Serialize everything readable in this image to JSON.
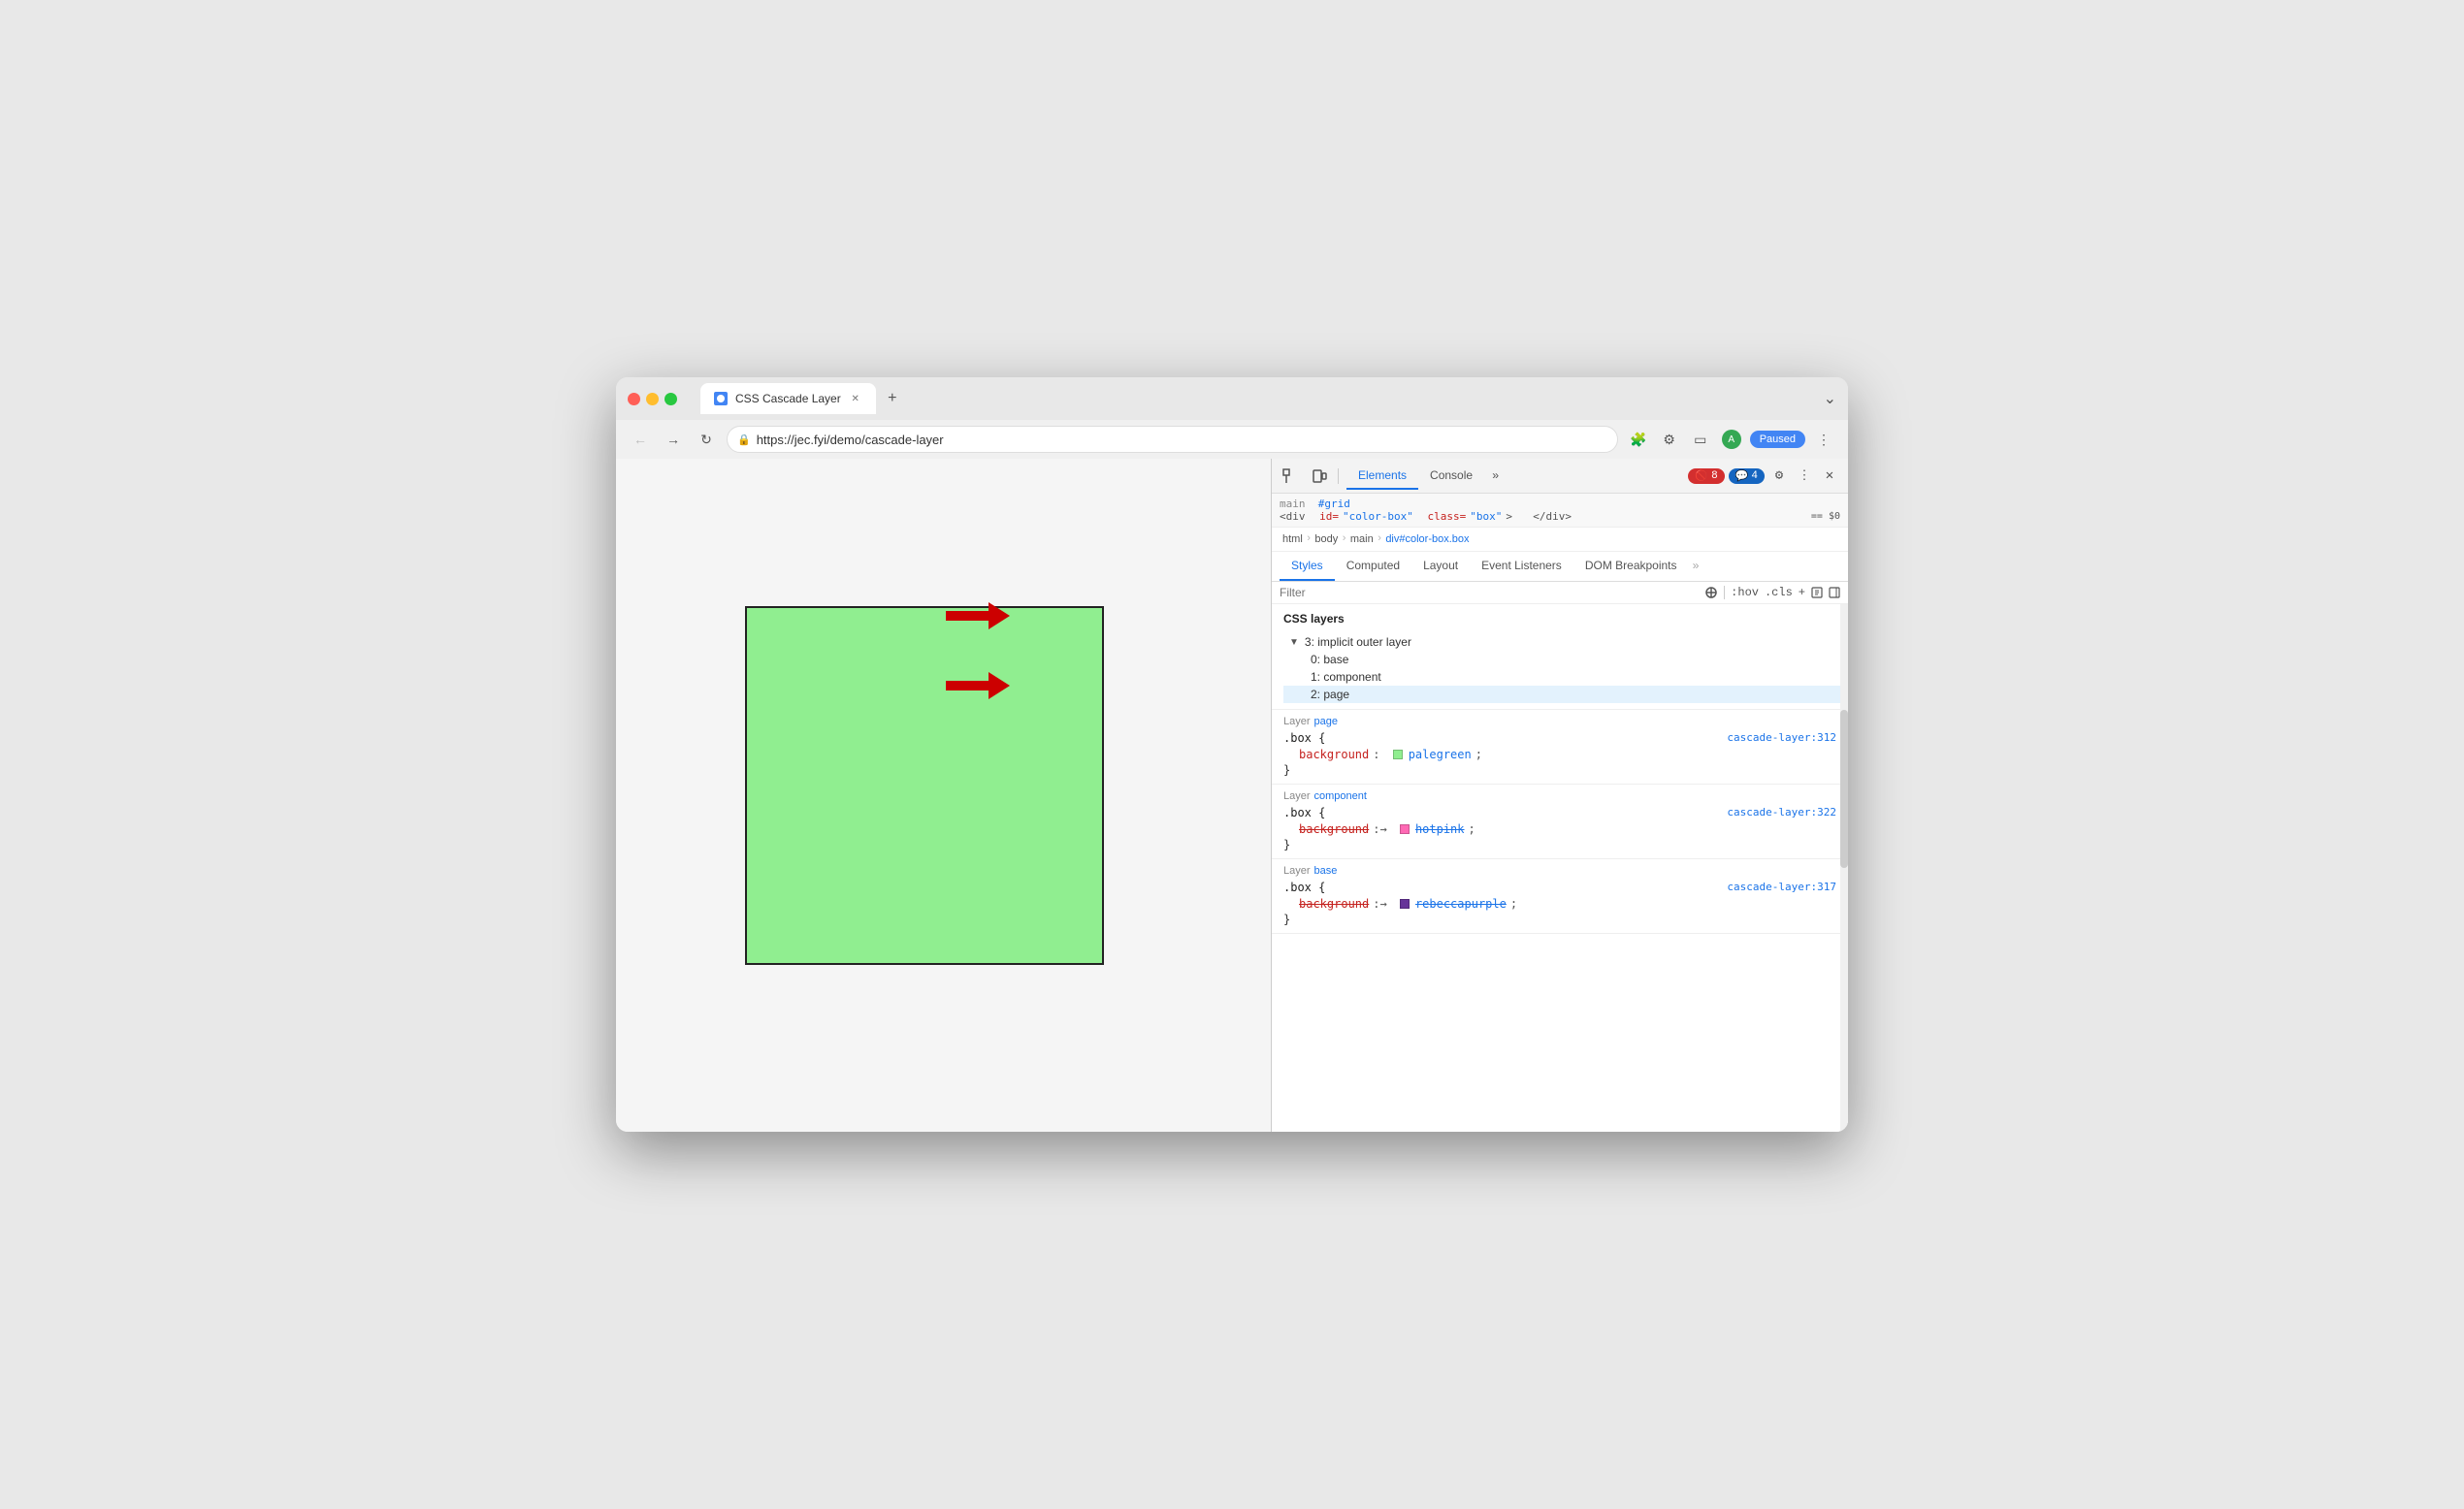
{
  "browser": {
    "title": "CSS Cascade Layer",
    "url": "https://jec.fyi/demo/cascade-layer",
    "tab_label": "CSS Cascade Layer",
    "paused_label": "Paused"
  },
  "devtools": {
    "tabs": [
      "Elements",
      "Console"
    ],
    "active_tab": "Elements",
    "error_count": "8",
    "warn_count": "4",
    "style_tabs": [
      "Styles",
      "Computed",
      "Layout",
      "Event Listeners",
      "DOM Breakpoints"
    ],
    "active_style_tab": "Styles",
    "filter_placeholder": "Filter",
    "pseudo_classes": ":hov",
    "class_label": ".cls"
  },
  "dom": {
    "parent_path": "main  #grid",
    "selected_element": "<div id=\"color-box\" class=\"box\">  </div>  == $0",
    "breadcrumb": [
      "html",
      "body",
      "main",
      "div#color-box.box"
    ]
  },
  "css_layers": {
    "header": "CSS layers",
    "items": [
      {
        "label": "3: implicit outer layer",
        "level": 0,
        "toggle": "▼"
      },
      {
        "label": "0: base",
        "level": 1
      },
      {
        "label": "1: component",
        "level": 1
      },
      {
        "label": "2: page",
        "level": 1,
        "selected": true
      }
    ]
  },
  "style_rules": [
    {
      "layer": "Layer",
      "layer_name": "page",
      "selector": ".box {",
      "source": "cascade-layer:312",
      "properties": [
        {
          "name": "background",
          "value": "palegreen",
          "color": "#90ee90",
          "struck": false
        }
      ]
    },
    {
      "layer": "Layer",
      "layer_name": "component",
      "selector": ".box {",
      "source": "cascade-layer:322",
      "properties": [
        {
          "name": "background",
          "value": "hotpink",
          "color": "#ff69b4",
          "struck": true
        }
      ]
    },
    {
      "layer": "Layer",
      "layer_name": "base",
      "selector": ".box {",
      "source": "cascade-layer:317",
      "properties": [
        {
          "name": "background",
          "value": "rebeccapurple",
          "color": "#663399",
          "struck": true
        }
      ]
    }
  ],
  "arrows": [
    {
      "id": "arrow-layers",
      "label": "points to CSS layers"
    },
    {
      "id": "arrow-layer-page",
      "label": "points to Layer page"
    }
  ]
}
